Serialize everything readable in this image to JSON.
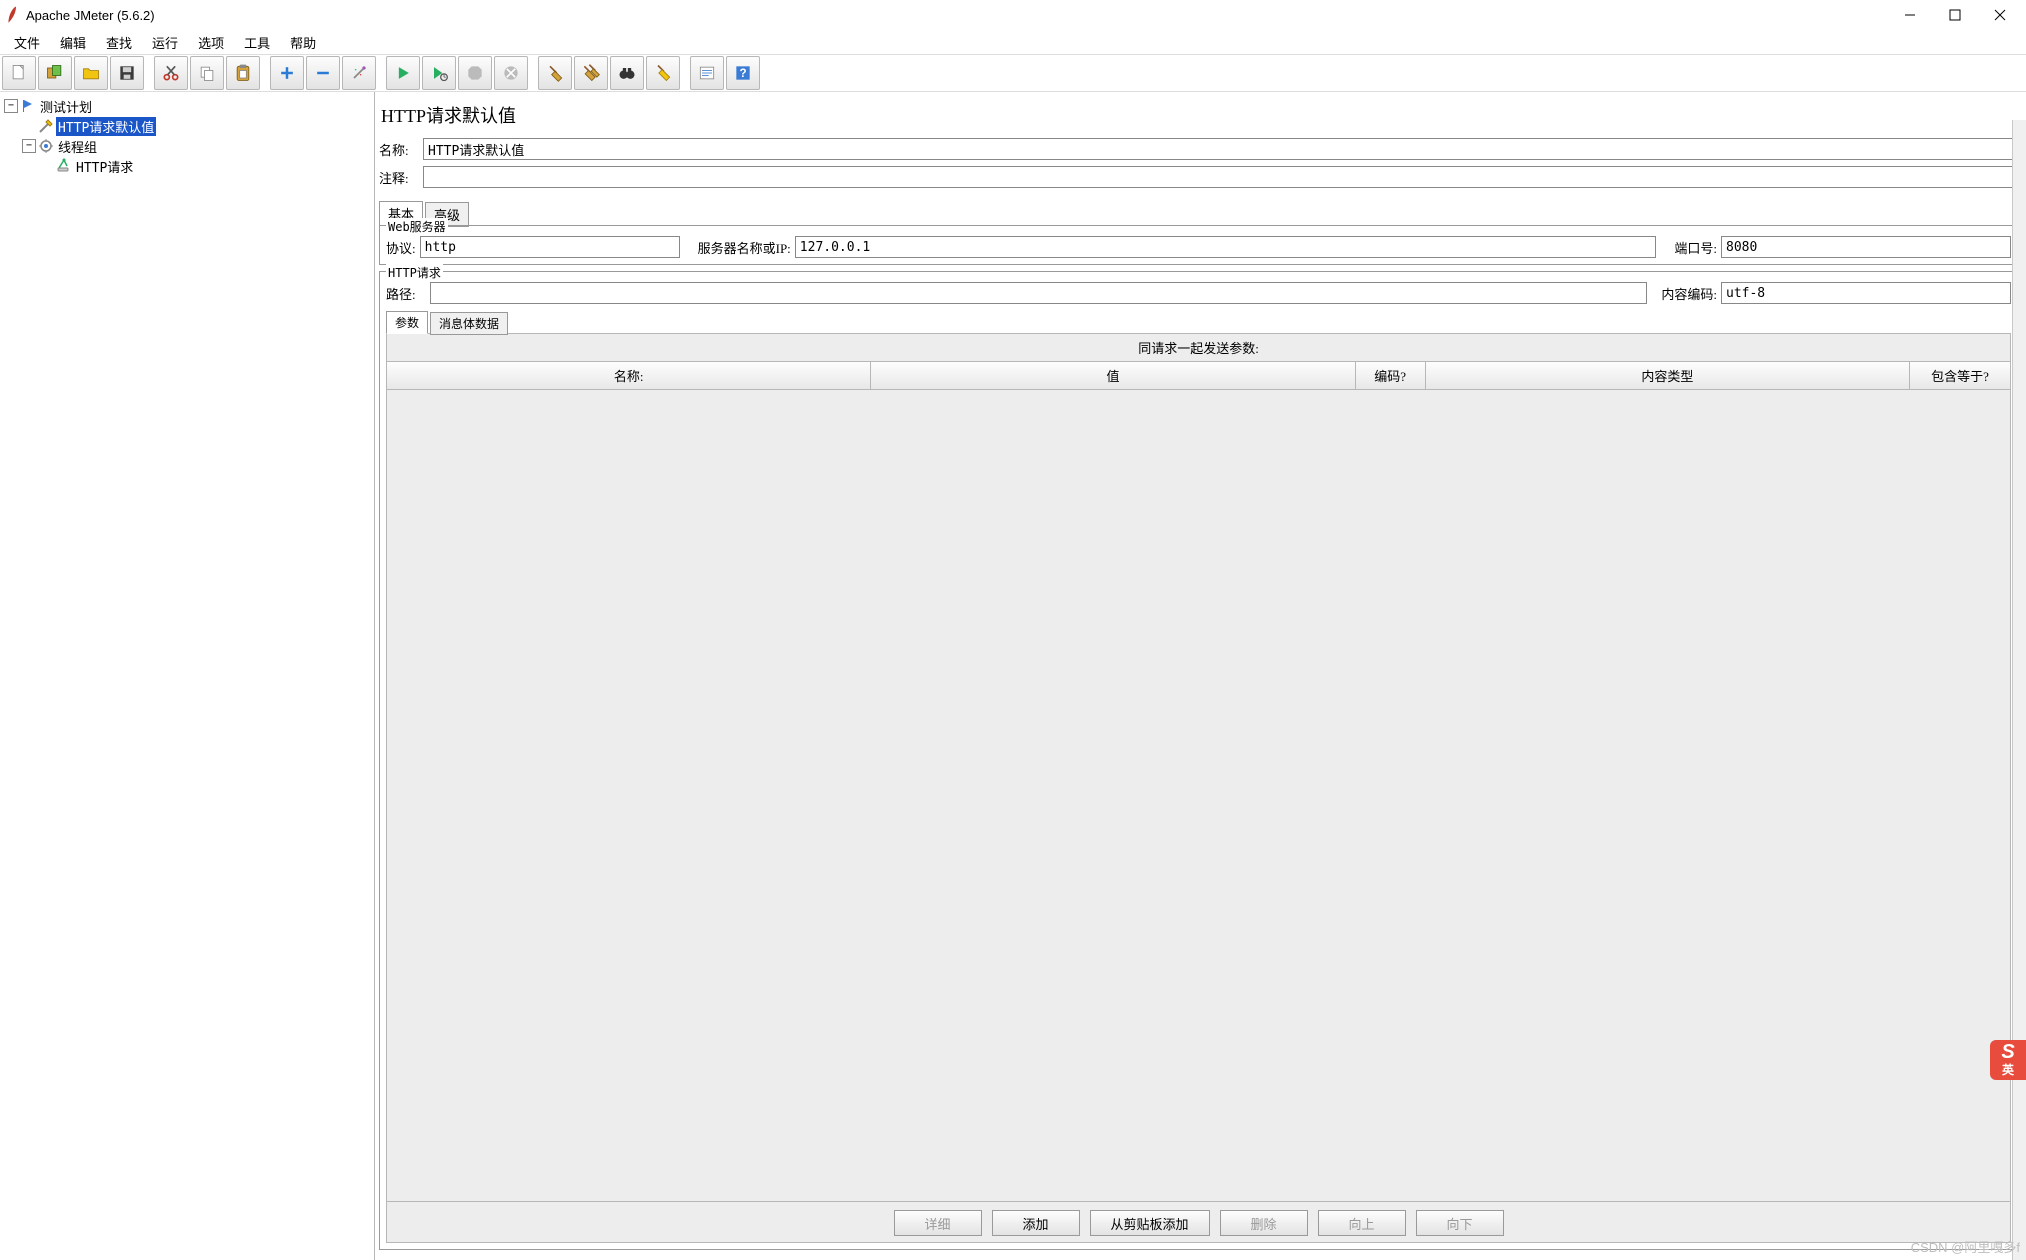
{
  "window": {
    "title": "Apache JMeter (5.6.2)"
  },
  "menubar": [
    "文件",
    "编辑",
    "查找",
    "运行",
    "选项",
    "工具",
    "帮助"
  ],
  "toolbar": {
    "new": "new-file-icon",
    "open_templates": "templates-icon",
    "open": "open-folder-icon",
    "save": "save-icon",
    "cut": "cut-icon",
    "copy": "copy-icon",
    "paste": "paste-icon",
    "plus": "plus-icon",
    "minus": "minus-icon",
    "wand": "wand-icon",
    "start": "start-icon",
    "start_no_timers": "start-no-timers-icon",
    "stop": "stop-icon",
    "shutdown": "shutdown-icon",
    "clear": "broom-icon",
    "clear_all": "broom-all-icon",
    "search": "binoculars-icon",
    "reset_search": "reset-broom-icon",
    "function_helper": "fn-helper-icon",
    "help": "help-icon"
  },
  "tree": {
    "root": {
      "label": "测试计划"
    },
    "http_defaults": {
      "label": "HTTP请求默认值"
    },
    "thread_group": {
      "label": "线程组"
    },
    "http_request": {
      "label": "HTTP请求"
    }
  },
  "panel": {
    "title": "HTTP请求默认值",
    "name_label": "名称:",
    "name_value": "HTTP请求默认值",
    "comment_label": "注释:",
    "comment_value": "",
    "tabs": {
      "basic": "基本",
      "advanced": "高级"
    },
    "webserver": {
      "legend": "Web服务器",
      "protocol_label": "协议:",
      "protocol_value": "http",
      "server_label": "服务器名称或IP:",
      "server_value": "127.0.0.1",
      "port_label": "端口号:",
      "port_value": "8080"
    },
    "httpreq": {
      "legend": "HTTP请求",
      "path_label": "路径:",
      "path_value": "",
      "encoding_label": "内容编码:",
      "encoding_value": "utf-8"
    },
    "sub_tabs": {
      "params": "参数",
      "body": "消息体数据"
    },
    "params_caption": "同请求一起发送参数:",
    "params_headers": {
      "name": "名称:",
      "value": "值",
      "encode": "编码?",
      "content_type": "内容类型",
      "include_equals": "包含等于?"
    },
    "buttons": {
      "detail": "详细",
      "add": "添加",
      "add_clipboard": "从剪贴板添加",
      "delete": "删除",
      "up": "向上",
      "down": "向下"
    }
  },
  "ime": {
    "s": "S",
    "lang": "英"
  },
  "watermark": "CSDN @阿里嘎多f"
}
